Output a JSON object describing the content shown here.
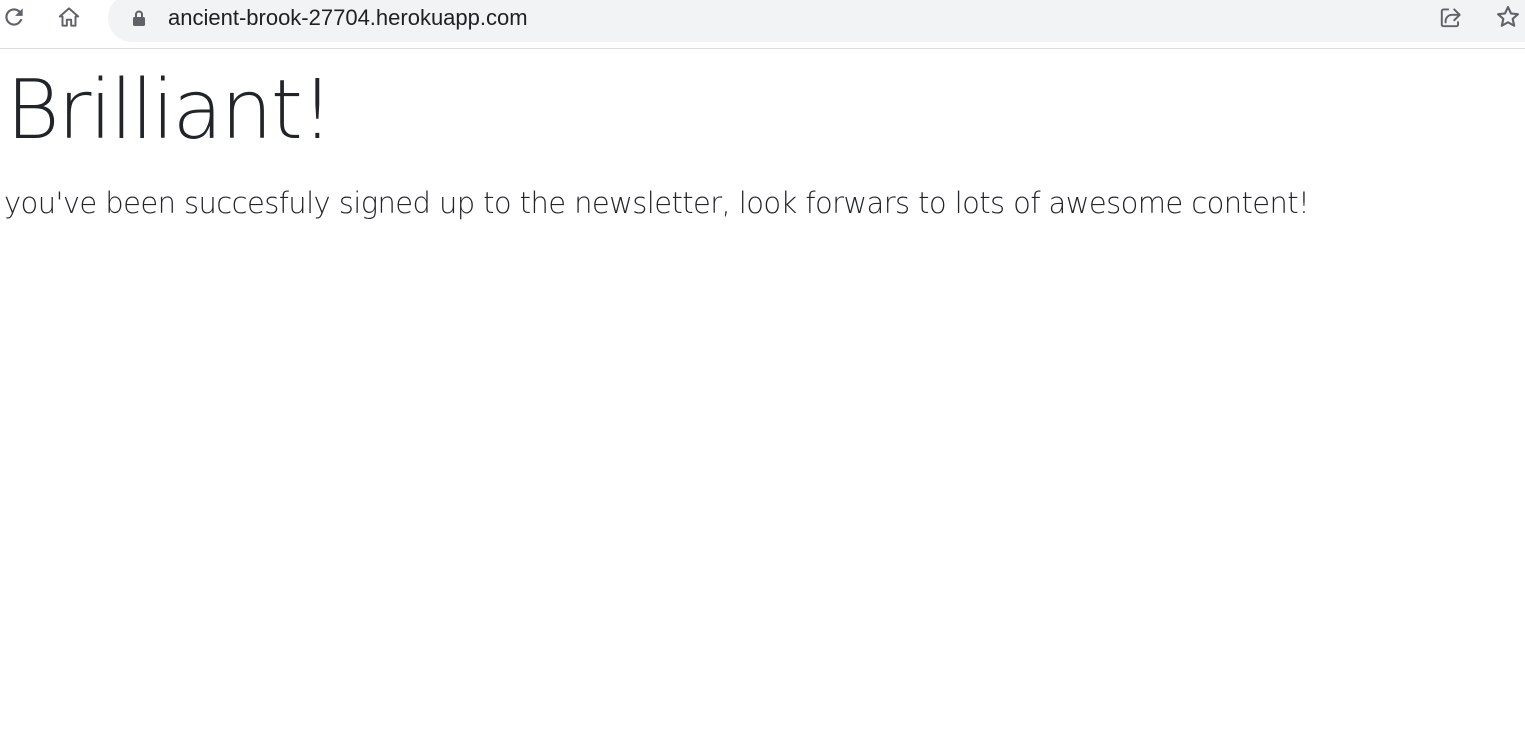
{
  "browser": {
    "url": "ancient-brook-27704.herokuapp.com",
    "icons": {
      "reload": "reload-icon",
      "home": "home-icon",
      "lock": "lock-icon",
      "share": "share-icon",
      "bookmark": "star-icon"
    }
  },
  "page": {
    "heading": "Brilliant!",
    "message": "you've been succesfuly signed up to the newsletter, look forwars to lots of awesome content!"
  },
  "colors": {
    "text": "#212529",
    "toolbar_icon": "#5f6368",
    "omnibox_bg": "#f1f3f4"
  }
}
